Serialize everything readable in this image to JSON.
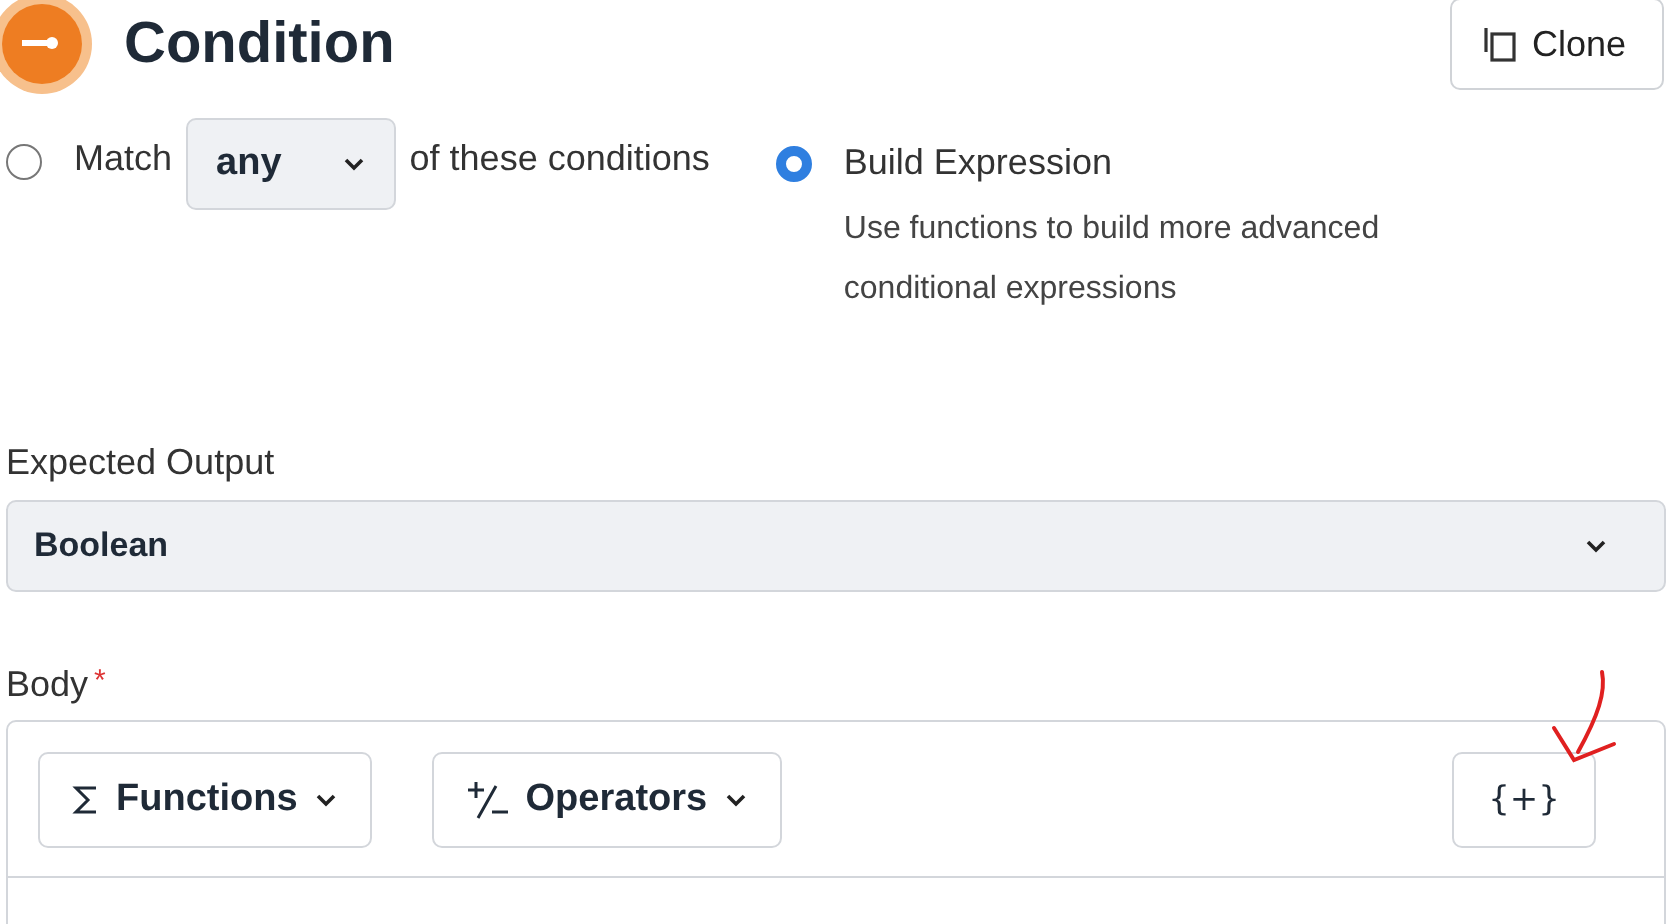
{
  "header": {
    "title": "Condition",
    "clone_button": "Clone"
  },
  "mode": [
    {
      "kind": "match",
      "selected": false,
      "label_before": "Match",
      "select_value": "any",
      "label_after": "of these conditions"
    },
    {
      "kind": "expression",
      "selected": true,
      "label": "Build Expression",
      "description": "Use functions to build more advanced conditional expressions"
    }
  ],
  "expected_output": {
    "label": "Expected Output",
    "value": "Boolean"
  },
  "body": {
    "label": "Body",
    "required_mark": "*",
    "toolbar": [
      {
        "kind": "functions",
        "label": "Functions"
      },
      {
        "kind": "operators",
        "label": "Operators"
      }
    ],
    "insert_button": "{+}"
  }
}
